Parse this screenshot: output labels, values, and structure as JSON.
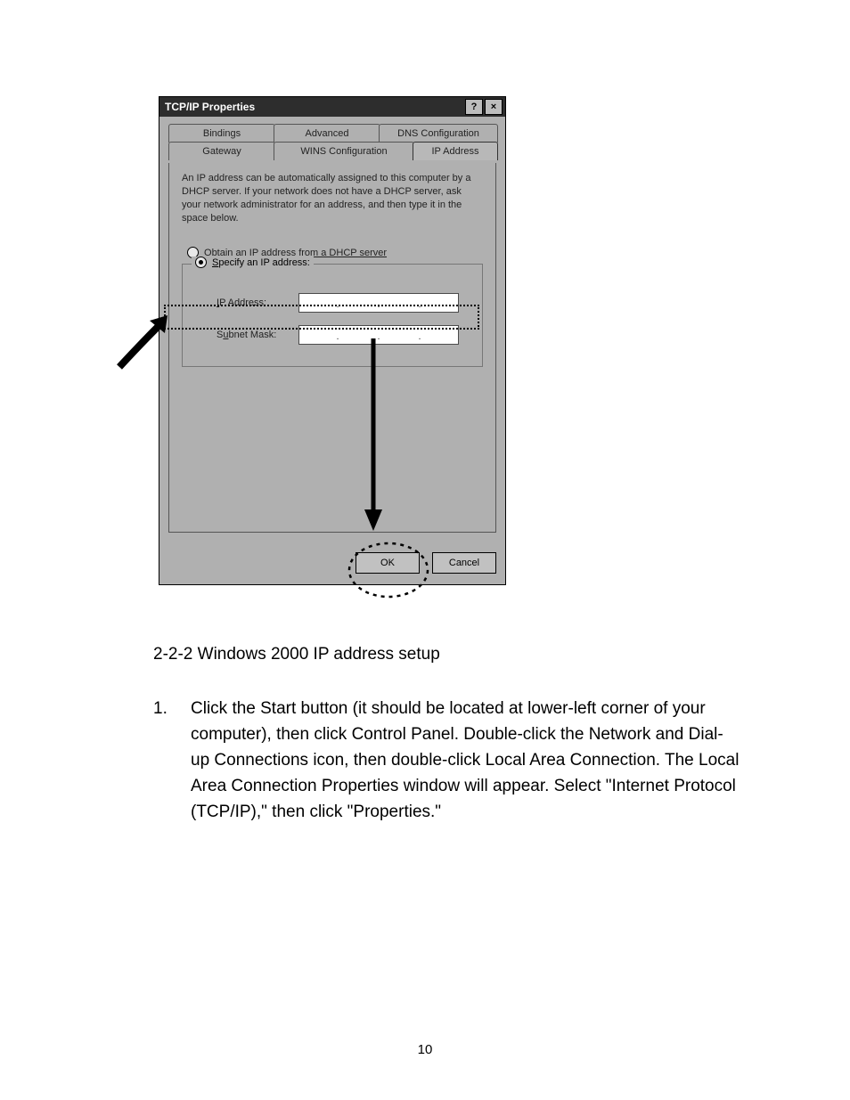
{
  "dialog": {
    "title": "TCP/IP Properties",
    "help_glyph": "?",
    "close_glyph": "×",
    "tabs": {
      "bindings": "Bindings",
      "advanced": "Advanced",
      "dns": "DNS Configuration",
      "gateway": "Gateway",
      "wins": "WINS Configuration",
      "ip": "IP Address"
    },
    "description": "An IP address can be automatically assigned to this computer by a DHCP server. If your network does not have a DHCP server, ask your network administrator for an address, and then type it in the space below.",
    "radio_obtain": "Obtain an IP address from a DHCP server",
    "radio_specify": "Specify an IP address:",
    "field_ip": "IP Address:",
    "field_mask": "Subnet Mask:",
    "btn_ok": "OK",
    "btn_cancel": "Cancel"
  },
  "doc": {
    "section": "2-2-2 Windows 2000 IP address setup",
    "list_num": "1.",
    "para": "Click the Start button (it should be located at lower-left corner of your computer), then click Control Panel. Double-click the Network and Dial-up Connections icon, then double-click Local Area Connection. The Local Area Connection Properties window will appear. Select \"Internet Protocol (TCP/IP),\" then click \"Properties.\"",
    "pagenum": "10"
  }
}
